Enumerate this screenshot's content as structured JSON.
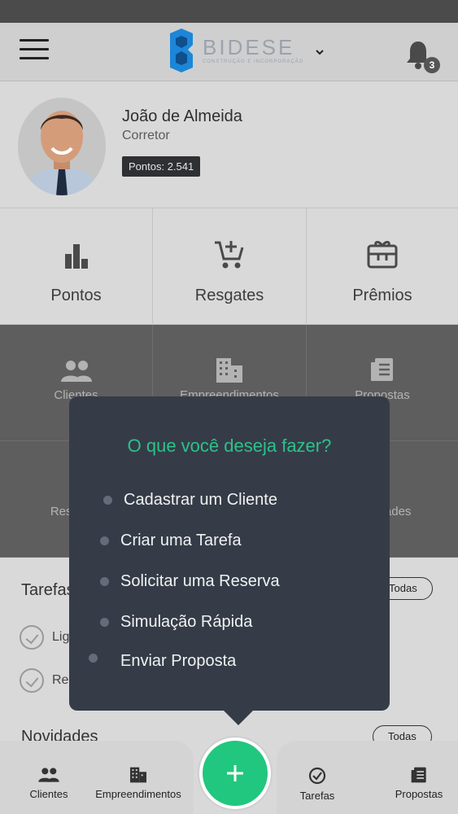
{
  "header": {
    "brand_word": "BIDESE",
    "brand_sub": "CONSTRUÇÃO E INCORPORAÇÃO",
    "notification_count": "3"
  },
  "profile": {
    "name": "João de Almeida",
    "role": "Corretor",
    "points": "Pontos: 2.541"
  },
  "grid": {
    "row1": [
      "Pontos",
      "Resgates",
      "Prêmios"
    ],
    "row2": [
      "Clientes",
      "Empreendimentos",
      "Propostas"
    ],
    "row3": [
      "Reservas",
      "",
      "Novidades"
    ]
  },
  "tasks": {
    "title": "Tarefas",
    "see_all": "Todas",
    "items": [
      "Ligar",
      "Reunião"
    ]
  },
  "news": {
    "title": "Novidades",
    "see_all": "Todas"
  },
  "popup": {
    "title": "O que você deseja fazer?",
    "options": [
      "Cadastrar um Cliente",
      "Criar uma Tarefa",
      "Solicitar uma Reserva",
      "Simulação Rápida",
      "Enviar Proposta"
    ]
  },
  "bottom_nav": {
    "clientes": "Clientes",
    "empreendimentos": "Empreendimentos",
    "tarefas": "Tarefas",
    "propostas": "Propostas"
  },
  "colors": {
    "accent_green": "#21c77e",
    "popup_bg": "#353c48",
    "popup_title": "#2ec18a"
  }
}
